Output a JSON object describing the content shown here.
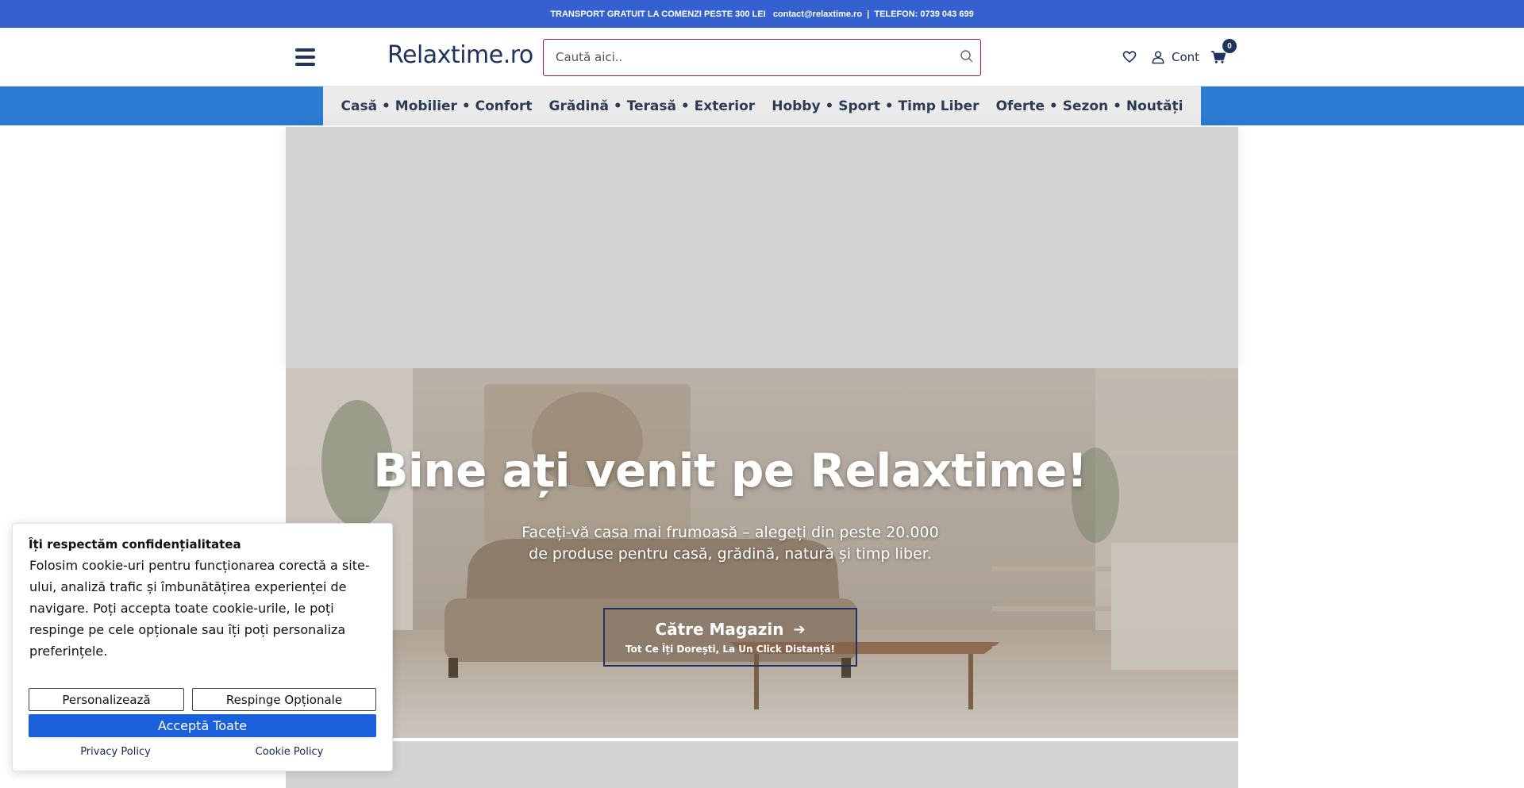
{
  "topbar": {
    "text": "TRANSPORT GRATUIT LA COMENZI PESTE 300 LEI   contact@relaxtime.ro  |  TELEFON: 0739 043 699"
  },
  "header": {
    "logo": "Relaxtime.ro",
    "search_placeholder": "Caută aici..",
    "account_label": "Cont",
    "cart_count": "0",
    "icons": [
      "menu-icon",
      "search-icon",
      "heart-icon",
      "user-icon",
      "cart-icon"
    ]
  },
  "nav": {
    "items": [
      {
        "label": "Casă • Mobilier • Confort"
      },
      {
        "label": "Grădină • Terasă • Exterior"
      },
      {
        "label": "Hobby • Sport • Timp Liber"
      },
      {
        "label": "Oferte • Sezon • Noutăți"
      }
    ]
  },
  "hero": {
    "title": "Bine ați venit pe Relaxtime!",
    "subtitle_line1": "Faceți-vă casa mai frumoasă – alegeți din peste 20.000",
    "subtitle_line2": "de produse pentru casă, grădină, natură și timp liber.",
    "button_label": "Către Magazin",
    "button_sub": "Tot Ce Îți Dorești, La Un Click Distanță!"
  },
  "cookie": {
    "title": "Îți respectăm confidențialitatea",
    "body": "Folosim cookie-uri pentru funcționarea corectă a site-ului, analiză trafic și îmbunătățirea experienței de navigare. Poți accepta toate cookie-urile, le poți respinge pe cele opționale sau îți poți personaliza preferințele.",
    "customize_label": "Personalizează",
    "reject_label": "Respinge Opționale",
    "accept_label": "Acceptă Toate",
    "privacy_label": "Privacy Policy",
    "cookie_policy_label": "Cookie Policy"
  },
  "colors": {
    "topbar": "#3461cf",
    "navbar": "#2b7bd2",
    "accept_button": "#1a60dd",
    "brand_dark": "#1f3260",
    "search_border": "#8e1d5b"
  }
}
